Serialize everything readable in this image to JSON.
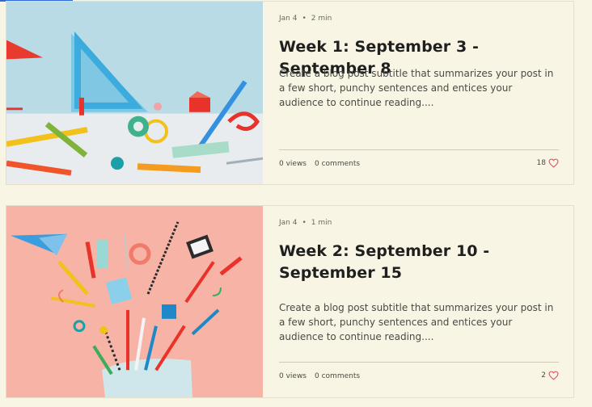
{
  "posts": [
    {
      "date": "Jan 4",
      "read_time": "2 min",
      "title": "Week 1: September 3 - September 8",
      "excerpt": "Create a blog post subtitle that summarizes your post in a few short, punchy sentences and entices your audience to continue reading....",
      "views": "0 views",
      "comments": "0 comments",
      "likes": "18",
      "image": "school-supplies-blue-background",
      "like_icon": "heart-icon",
      "like_color": "#e04a5a"
    },
    {
      "date": "Jan 4",
      "read_time": "1 min",
      "title": "Week 2: September 10 - September 15",
      "excerpt": "Create a blog post subtitle that summarizes your post in a few short, punchy sentences and entices your audience to continue reading....",
      "views": "0 views",
      "comments": "0 comments",
      "likes": "2",
      "image": "school-supplies-pink-background",
      "like_icon": "heart-icon",
      "like_color": "#e04a5a"
    }
  ]
}
